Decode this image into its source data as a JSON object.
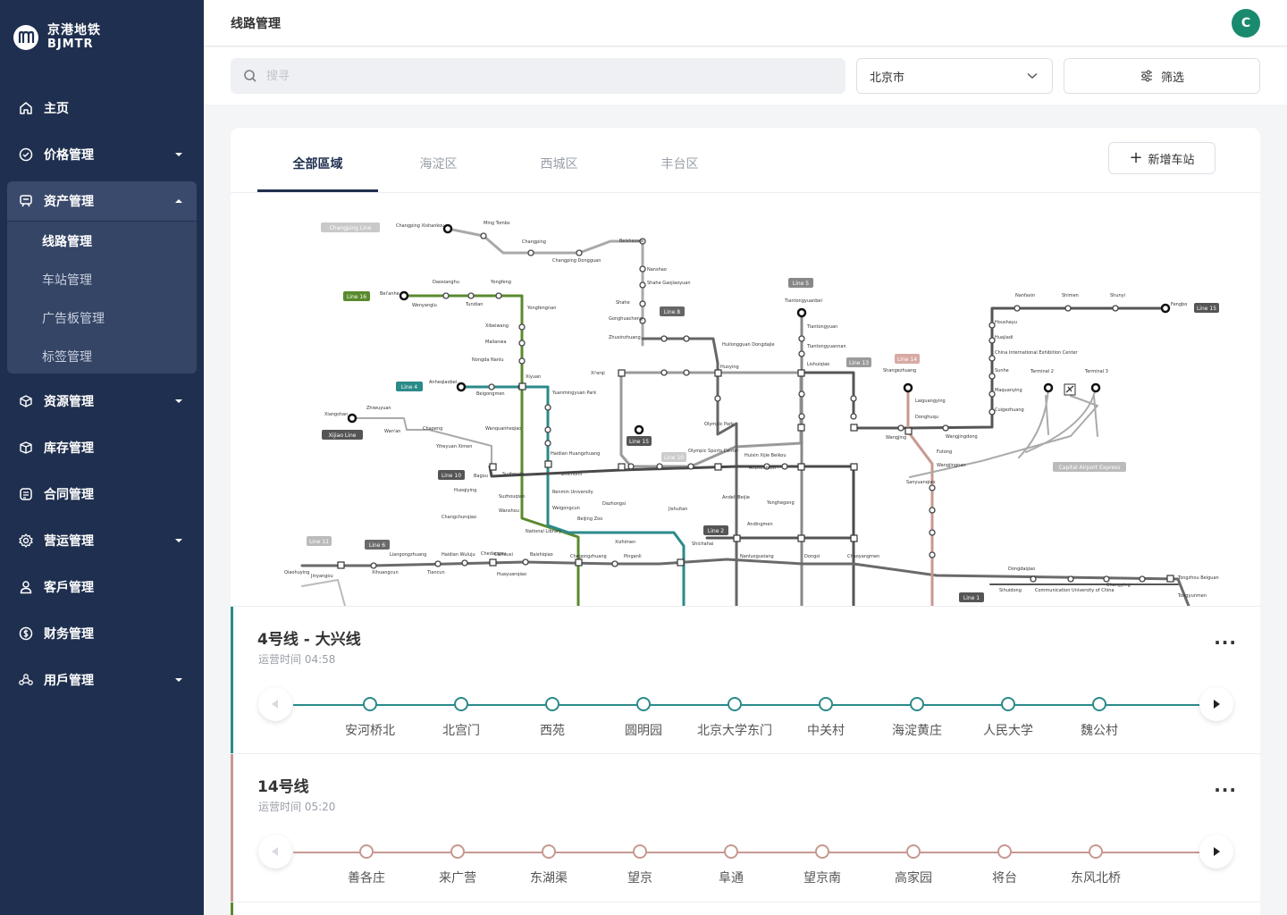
{
  "brand": {
    "name_cn": "京港地铁",
    "name_en": "BJMTR"
  },
  "sidebar": {
    "items": [
      {
        "label": "主页",
        "icon": "home-icon"
      },
      {
        "label": "价格管理",
        "icon": "price-tag-icon"
      },
      {
        "label": "资产管理",
        "icon": "asset-icon"
      },
      {
        "label": "资源管理",
        "icon": "resource-icon"
      },
      {
        "label": "库存管理",
        "icon": "box-icon"
      },
      {
        "label": "合同管理",
        "icon": "document-icon"
      },
      {
        "label": "营运管理",
        "icon": "settings-icon"
      },
      {
        "label": "客戶管理",
        "icon": "user-icon"
      },
      {
        "label": "财务管理",
        "icon": "dollar-icon"
      },
      {
        "label": "用戶管理",
        "icon": "users-icon"
      }
    ],
    "submenu": [
      "线路管理",
      "车站管理",
      "广告板管理",
      "标签管理"
    ],
    "active_submenu": "线路管理"
  },
  "header": {
    "title": "线路管理",
    "avatar_initial": "C"
  },
  "toolbar": {
    "search_placeholder": "搜寻",
    "city": "北京市",
    "filter_label": "筛选"
  },
  "tabs": [
    "全部區域",
    "海淀区",
    "西城区",
    "丰台区"
  ],
  "add_station_label": "新增车站",
  "map": {
    "lines": [
      "Changping Line",
      "Line 16",
      "Line 4",
      "Xijiao Line",
      "Line 10",
      "Line 6",
      "Line 11",
      "Line 8",
      "Line 5",
      "Line 13",
      "Line 14",
      "Line 15",
      "Line 2",
      "Line 1",
      "Capital Airport Express"
    ],
    "stations": [
      "Changping Xishankou",
      "Ming Tombs",
      "Changping",
      "Changping Dongguan",
      "Beishaowa",
      "Nanshao",
      "Shahe Gaojiaoyuan",
      "Shahe",
      "Gonghuacheng",
      "Zhuxinzhuang",
      "Bei'anhe",
      "Daoxianghu",
      "Yongfeng",
      "Wenyanglu",
      "Tundian",
      "Yongfengnan",
      "Xibeiwang",
      "Malianwa",
      "Nongda Nanlu",
      "Xi'erqi",
      "Anheqiaobei",
      "Beigongmen",
      "Xiyuan",
      "Yuanmingyuan Park",
      "Xiangshan",
      "Zhiwuyuan",
      "Wan'an",
      "Chapeng",
      "Yiheyuan Ximen",
      "Wanquanheqiao",
      "Bagou",
      "Suzhoujie",
      "Haidian Huangzhuang",
      "Zhichunli",
      "Tiantongyuanbei",
      "Tiantongyuan",
      "Tiantongyuannan",
      "Lishuiqiao",
      "Liyuan",
      "Huilongguan",
      "Huoying",
      "Pingxifu",
      "Longze",
      "Fengbo",
      "Nanfaxin",
      "Shimen",
      "Shunyi",
      "Fengbo",
      "Terminal 2",
      "Terminal 3",
      "Dongzhimen",
      "Sanyuanqiao",
      "Wangjing",
      "Shaoyaoju",
      "Xizhimen",
      "Jishuitan",
      "Guloudajie",
      "Andingmen",
      "Yonghegong Lama Temple",
      "Dongsishitiao",
      "Chaoyangmen",
      "Jianguomen",
      "Beijing Railway Station",
      "Xidan",
      "Fuxingmen",
      "Gongzhufen",
      "Muxidi",
      "Military Museum",
      "Tiananmen West",
      "Tiananmen East",
      "Wangfujing",
      "Dongdan",
      "Guomao",
      "Dawanglu",
      "Sihui",
      "Sihuidong",
      "Communication University of China",
      "Shuangqiao",
      "Guanzhuang",
      "Haojiafu",
      "Tongzhou Beiguan",
      "Tongyunmen"
    ]
  },
  "line_panels": [
    {
      "name": "4号线 - 大兴线",
      "time": "运营时间 04:58",
      "color": "#2b8a8a",
      "stations": [
        "安河桥北",
        "北宫门",
        "西苑",
        "圆明园",
        "北京大学东门",
        "中关村",
        "海淀黄庄",
        "人民大学",
        "魏公村"
      ]
    },
    {
      "name": "14号线",
      "time": "运营时间 05:20",
      "color": "#c79891",
      "stations": [
        "善各庄",
        "来广营",
        "东湖渠",
        "望京",
        "阜通",
        "望京南",
        "高家园",
        "将台",
        "东风北桥"
      ]
    }
  ],
  "colors": {
    "sidebar": "#1f2f4f",
    "accent": "#1a8a6e",
    "line4": "#2b8a8a",
    "line14": "#c79891",
    "line16": "#5a8a2e"
  }
}
